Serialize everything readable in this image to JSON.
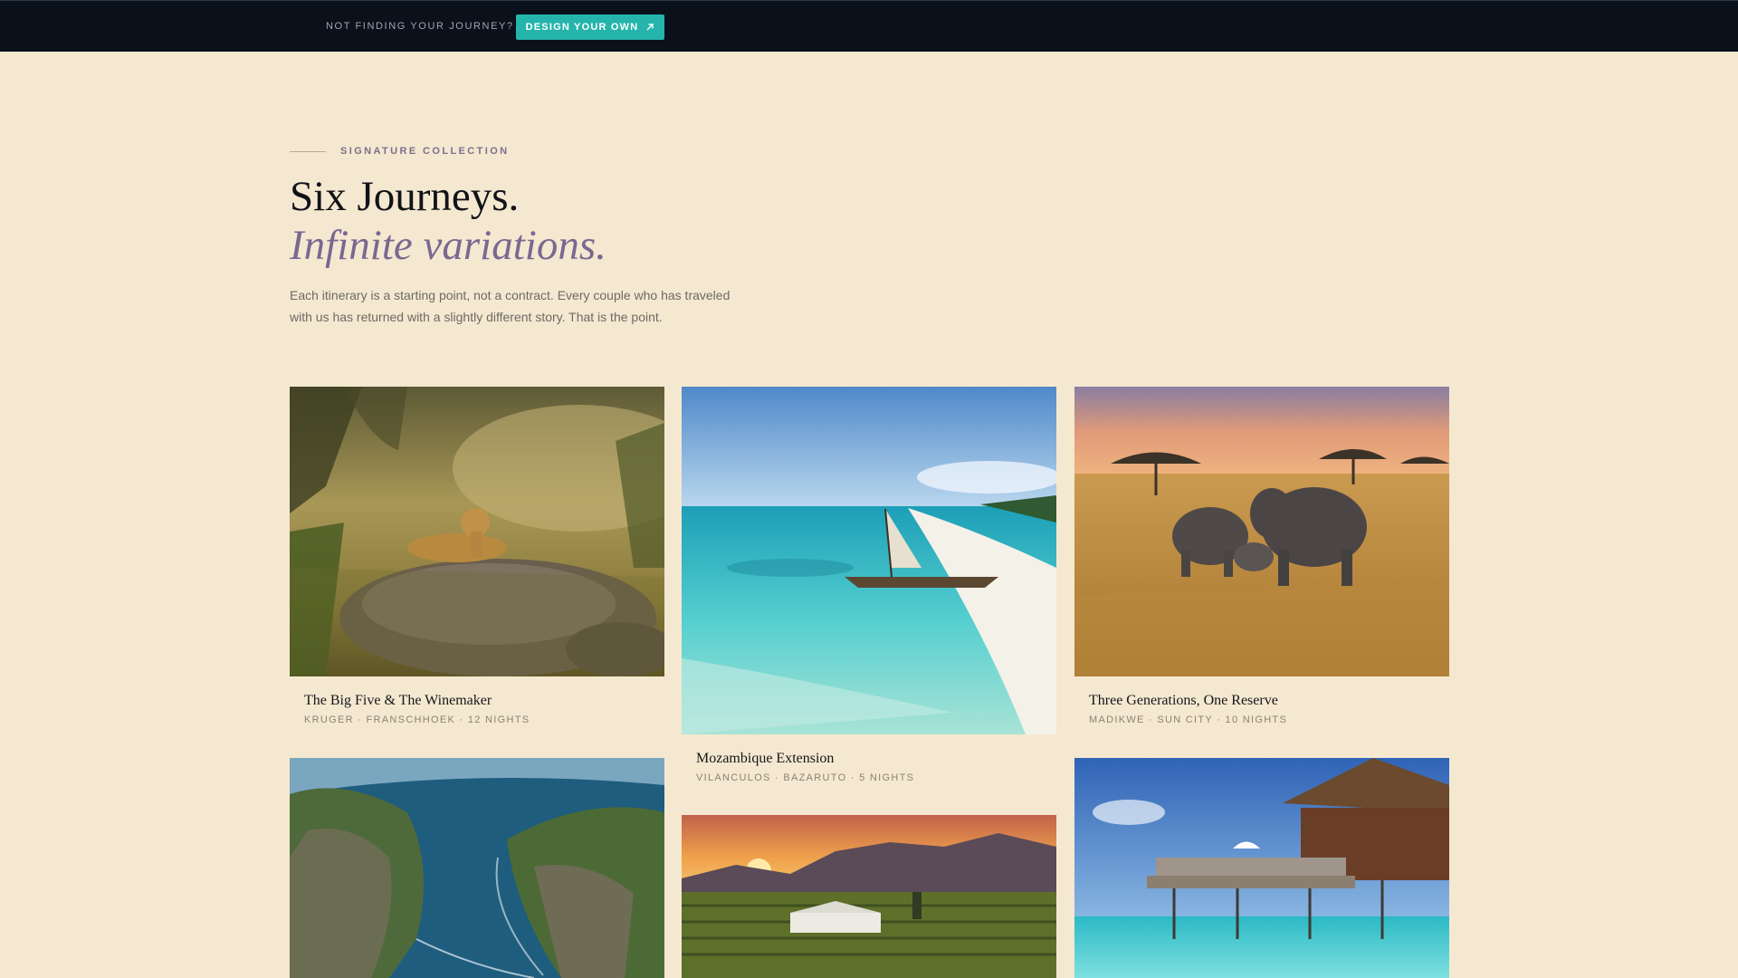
{
  "topbar": {
    "prompt": "NOT FINDING YOUR JOURNEY?",
    "cta_label": "DESIGN YOUR OWN",
    "cta_icon": "arrow-up-right-icon"
  },
  "section": {
    "eyebrow": "SIGNATURE COLLECTION",
    "headline": "Six Journeys.",
    "headline_italic": "Infinite variations.",
    "intro": "Each itinerary is a starting point, not a contract. Every couple who has traveled with us has returned with a slightly different story. That is the point."
  },
  "journeys": [
    {
      "title": "The Big Five & The Winemaker",
      "meta": "KRUGER · FRANSCHHOEK · 12 NIGHTS"
    },
    {
      "title": "Mozambique Extension",
      "meta": "VILANCULOS · BAZARUTO · 5 NIGHTS"
    },
    {
      "title": "Three Generations, One Reserve",
      "meta": "MADIKWE · SUN CITY · 10 NIGHTS"
    }
  ],
  "colors": {
    "background": "#f5e8d0",
    "topbar": "#0b111b",
    "accent": "#25b4ac",
    "italic_accent": "#7a6891"
  }
}
